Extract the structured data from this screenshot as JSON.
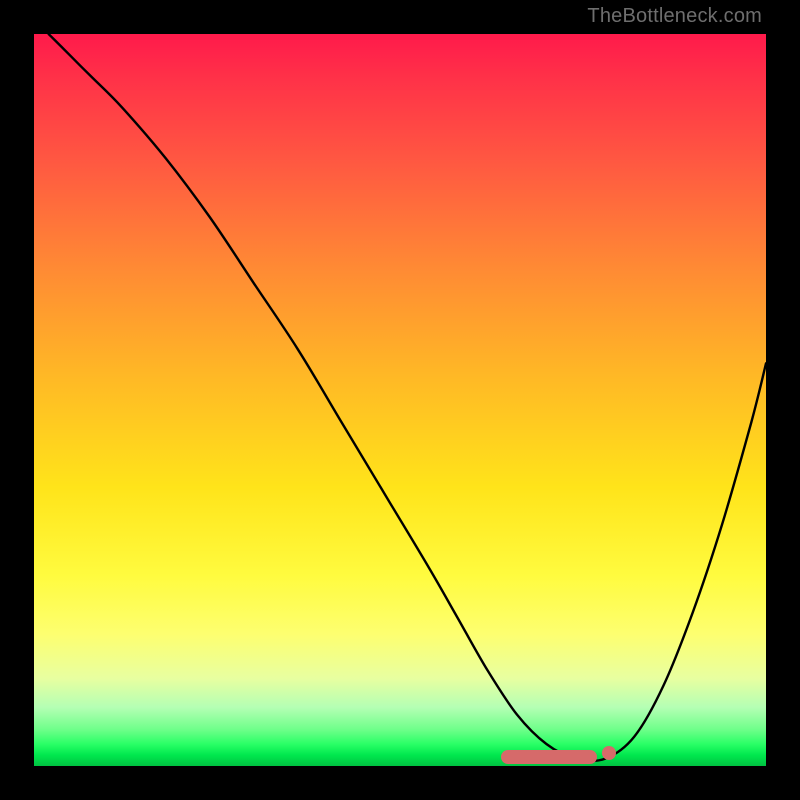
{
  "watermark": "TheBottleneck.com",
  "chart_data": {
    "type": "line",
    "title": "",
    "xlabel": "",
    "ylabel": "",
    "xlim": [
      0,
      100
    ],
    "ylim": [
      0,
      100
    ],
    "grid": false,
    "background": "red-yellow-green vertical gradient (red top, green bottom)",
    "series": [
      {
        "name": "bottleneck-curve",
        "color": "#000000",
        "x": [
          2,
          4,
          6,
          8,
          12,
          18,
          24,
          30,
          36,
          42,
          48,
          54,
          58,
          62,
          66,
          70,
          74,
          78,
          82,
          86,
          90,
          94,
          98,
          100
        ],
        "y": [
          100,
          98,
          96,
          94,
          90,
          83,
          75,
          66,
          57,
          47,
          37,
          27,
          20,
          13,
          7,
          3,
          1,
          1,
          4,
          11,
          21,
          33,
          47,
          55
        ]
      }
    ],
    "annotations": [
      {
        "name": "optimal-range-marker",
        "color": "#d66a6a",
        "x_start": 65,
        "x_end": 80,
        "y": 1
      }
    ]
  }
}
